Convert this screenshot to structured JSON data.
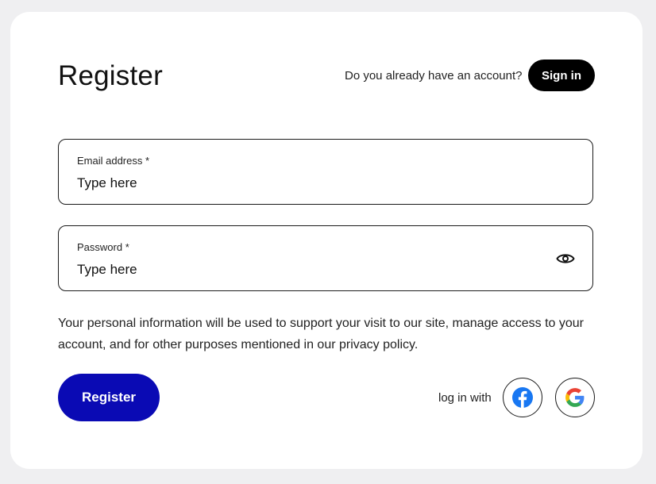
{
  "header": {
    "title": "Register",
    "account_question": "Do you already have an account?",
    "signin_label": "Sign in"
  },
  "form": {
    "email": {
      "label": "Email address *",
      "value": "",
      "placeholder": "Type here"
    },
    "password": {
      "label": "Password *",
      "value": "",
      "placeholder": "Type here",
      "toggle_icon": "eye-icon"
    },
    "privacy_text": "Your personal information will be used to support your visit to our site, manage access to your account, and for other purposes mentioned in our privacy policy.",
    "register_label": "Register"
  },
  "social": {
    "label": "log in with",
    "providers": [
      {
        "name": "facebook",
        "icon": "facebook-icon",
        "color": "#1877F2"
      },
      {
        "name": "google",
        "icon": "google-icon",
        "colors": [
          "#4285F4",
          "#34A853",
          "#FBBC05",
          "#EA4335"
        ]
      }
    ]
  },
  "colors": {
    "background": "#efeff1",
    "card": "#ffffff",
    "primary_button": "#0a0ab4",
    "signin_button": "#000000"
  }
}
